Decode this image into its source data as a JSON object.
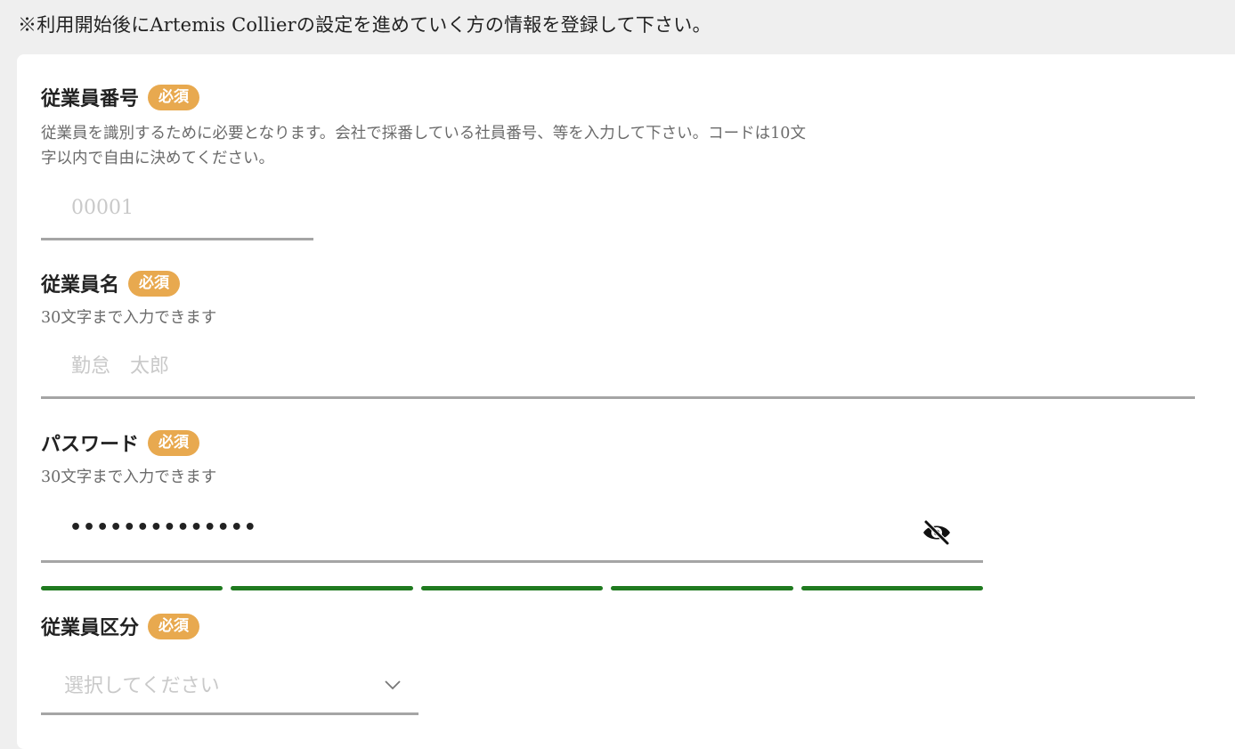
{
  "notice": "※利用開始後にArtemis Collierの設定を進めていく方の情報を登録して下さい。",
  "required_badge": "必須",
  "fields": {
    "employee_number": {
      "label": "従業員番号",
      "help_line1": "従業員を識別するために必要となります。会社で採番している社員番号、等を入力して下さい。コードは10文",
      "help_line2": "字以内で自由に決めてください。",
      "placeholder": "00001",
      "value": ""
    },
    "employee_name": {
      "label": "従業員名",
      "help": "30文字まで入力できます",
      "placeholder": "勤怠　太郎",
      "value": ""
    },
    "password": {
      "label": "パスワード",
      "help": "30文字まで入力できます",
      "masked_value": "••••••••••••••",
      "visibility_icon": "eye-off-icon",
      "strength_segments": 5,
      "strength_level": 1.0,
      "strength_color": "#1f7a1f"
    },
    "employee_category": {
      "label": "従業員区分",
      "placeholder": "選択してください",
      "chevron_icon": "chevron-down-icon"
    }
  },
  "colors": {
    "badge": "#e8a94f",
    "background": "#efefef",
    "card": "#ffffff",
    "underline": "#a5a5a5"
  }
}
